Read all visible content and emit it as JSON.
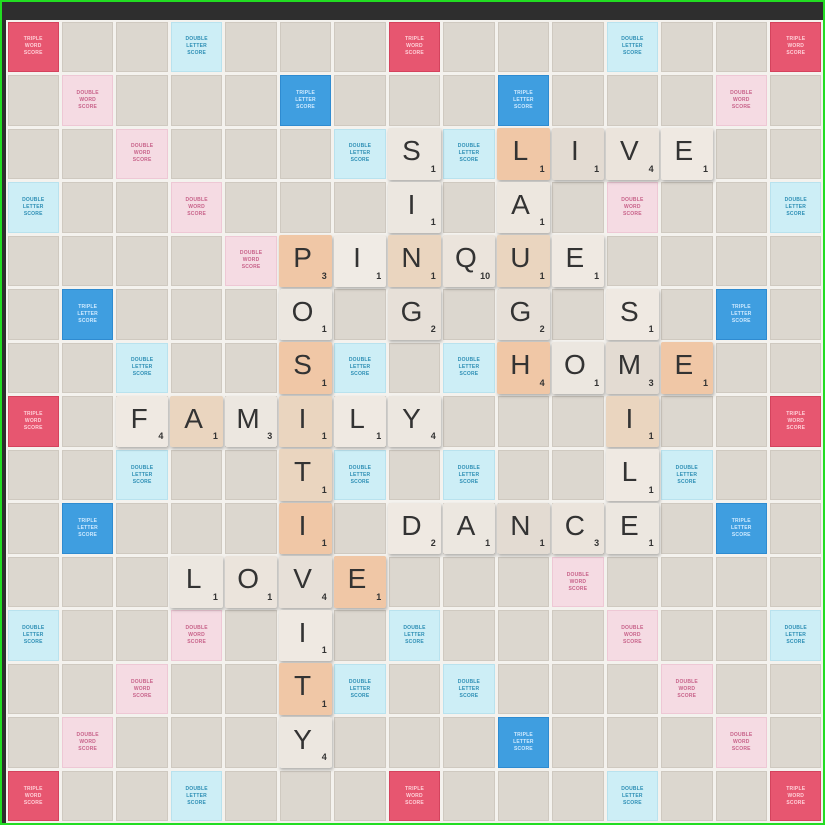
{
  "board": {
    "grid_size": 15,
    "colors": {
      "board_bg": "#f4f2ee",
      "square": "#dcd7cf",
      "double_word": "#f5dbe3",
      "double_letter": "#cdeef6",
      "triple_letter": "#3f9ee0",
      "triple_word": "#e75670",
      "frame": "#2e2e2e",
      "outline": "#22dd22"
    },
    "premium_labels": {
      "DW": [
        "DOUBLE",
        "WORD",
        "SCORE"
      ],
      "DL": [
        "DOUBLE",
        "LETTER",
        "SCORE"
      ],
      "TL": [
        "TRIPLE",
        "LETTER",
        "SCORE"
      ],
      "TW": [
        "TRIPLE",
        "WORD",
        "SCORE"
      ]
    },
    "premium_squares": [
      {
        "r": 0,
        "c": 0,
        "t": "TW"
      },
      {
        "r": 0,
        "c": 3,
        "t": "DL"
      },
      {
        "r": 0,
        "c": 7,
        "t": "TW"
      },
      {
        "r": 0,
        "c": 11,
        "t": "DL"
      },
      {
        "r": 0,
        "c": 14,
        "t": "TW"
      },
      {
        "r": 1,
        "c": 1,
        "t": "DW"
      },
      {
        "r": 1,
        "c": 5,
        "t": "TL"
      },
      {
        "r": 1,
        "c": 9,
        "t": "TL"
      },
      {
        "r": 1,
        "c": 13,
        "t": "DW"
      },
      {
        "r": 2,
        "c": 2,
        "t": "DW"
      },
      {
        "r": 2,
        "c": 6,
        "t": "DL"
      },
      {
        "r": 2,
        "c": 8,
        "t": "DL"
      },
      {
        "r": 2,
        "c": 12,
        "t": "DW"
      },
      {
        "r": 3,
        "c": 0,
        "t": "DL"
      },
      {
        "r": 3,
        "c": 3,
        "t": "DW"
      },
      {
        "r": 3,
        "c": 11,
        "t": "DW"
      },
      {
        "r": 3,
        "c": 14,
        "t": "DL"
      },
      {
        "r": 4,
        "c": 4,
        "t": "DW"
      },
      {
        "r": 4,
        "c": 10,
        "t": "DW"
      },
      {
        "r": 5,
        "c": 1,
        "t": "TL"
      },
      {
        "r": 5,
        "c": 5,
        "t": "TL"
      },
      {
        "r": 5,
        "c": 9,
        "t": "TL"
      },
      {
        "r": 5,
        "c": 13,
        "t": "TL"
      },
      {
        "r": 6,
        "c": 2,
        "t": "DL"
      },
      {
        "r": 6,
        "c": 6,
        "t": "DL"
      },
      {
        "r": 6,
        "c": 8,
        "t": "DL"
      },
      {
        "r": 6,
        "c": 12,
        "t": "DL"
      },
      {
        "r": 7,
        "c": 0,
        "t": "TW"
      },
      {
        "r": 7,
        "c": 3,
        "t": "DL"
      },
      {
        "r": 7,
        "c": 7,
        "t": "DW"
      },
      {
        "r": 7,
        "c": 11,
        "t": "DL"
      },
      {
        "r": 7,
        "c": 14,
        "t": "TW"
      },
      {
        "r": 8,
        "c": 2,
        "t": "DL"
      },
      {
        "r": 8,
        "c": 6,
        "t": "DL"
      },
      {
        "r": 8,
        "c": 8,
        "t": "DL"
      },
      {
        "r": 8,
        "c": 12,
        "t": "DL"
      },
      {
        "r": 9,
        "c": 1,
        "t": "TL"
      },
      {
        "r": 9,
        "c": 5,
        "t": "TL"
      },
      {
        "r": 9,
        "c": 9,
        "t": "TL"
      },
      {
        "r": 9,
        "c": 13,
        "t": "TL"
      },
      {
        "r": 10,
        "c": 4,
        "t": "DW"
      },
      {
        "r": 10,
        "c": 10,
        "t": "DW"
      },
      {
        "r": 11,
        "c": 0,
        "t": "DL"
      },
      {
        "r": 11,
        "c": 3,
        "t": "DW"
      },
      {
        "r": 11,
        "c": 7,
        "t": "DL"
      },
      {
        "r": 11,
        "c": 11,
        "t": "DW"
      },
      {
        "r": 11,
        "c": 14,
        "t": "DL"
      },
      {
        "r": 12,
        "c": 2,
        "t": "DW"
      },
      {
        "r": 12,
        "c": 6,
        "t": "DL"
      },
      {
        "r": 12,
        "c": 8,
        "t": "DL"
      },
      {
        "r": 12,
        "c": 12,
        "t": "DW"
      },
      {
        "r": 13,
        "c": 1,
        "t": "DW"
      },
      {
        "r": 13,
        "c": 5,
        "t": "TL"
      },
      {
        "r": 13,
        "c": 9,
        "t": "TL"
      },
      {
        "r": 13,
        "c": 13,
        "t": "DW"
      },
      {
        "r": 14,
        "c": 0,
        "t": "TW"
      },
      {
        "r": 14,
        "c": 3,
        "t": "DL"
      },
      {
        "r": 14,
        "c": 7,
        "t": "TW"
      },
      {
        "r": 14,
        "c": 11,
        "t": "DL"
      },
      {
        "r": 14,
        "c": 14,
        "t": "TW"
      }
    ],
    "tiles": [
      {
        "r": 2,
        "c": 7,
        "l": "S",
        "p": "1",
        "tone": "#ece7e0"
      },
      {
        "r": 2,
        "c": 9,
        "l": "L",
        "p": "1",
        "tone": "#f0c7a6"
      },
      {
        "r": 2,
        "c": 10,
        "l": "I",
        "p": "1",
        "tone": "#e3dbd2"
      },
      {
        "r": 2,
        "c": 11,
        "l": "V",
        "p": "4",
        "tone": "#ebe4dc"
      },
      {
        "r": 2,
        "c": 12,
        "l": "E",
        "p": "1",
        "tone": "#efe9e2"
      },
      {
        "r": 3,
        "c": 7,
        "l": "I",
        "p": "1",
        "tone": "#ece7e0"
      },
      {
        "r": 3,
        "c": 9,
        "l": "A",
        "p": "1",
        "tone": "#ede7df"
      },
      {
        "r": 4,
        "c": 5,
        "l": "P",
        "p": "3",
        "tone": "#f0c7a6"
      },
      {
        "r": 4,
        "c": 6,
        "l": "I",
        "p": "1",
        "tone": "#f0ebe5"
      },
      {
        "r": 4,
        "c": 7,
        "l": "N",
        "p": "1",
        "tone": "#ead5bf"
      },
      {
        "r": 4,
        "c": 8,
        "l": "Q",
        "p": "10",
        "tone": "#ebe4dc"
      },
      {
        "r": 4,
        "c": 9,
        "l": "U",
        "p": "1",
        "tone": "#ead5bf"
      },
      {
        "r": 4,
        "c": 10,
        "l": "E",
        "p": "1",
        "tone": "#efe9e2"
      },
      {
        "r": 5,
        "c": 5,
        "l": "O",
        "p": "1",
        "tone": "#ece7e0"
      },
      {
        "r": 5,
        "c": 7,
        "l": "G",
        "p": "2",
        "tone": "#e7e0d8"
      },
      {
        "r": 5,
        "c": 9,
        "l": "G",
        "p": "2",
        "tone": "#e7e0d8"
      },
      {
        "r": 5,
        "c": 11,
        "l": "S",
        "p": "1",
        "tone": "#efe9e2"
      },
      {
        "r": 6,
        "c": 5,
        "l": "S",
        "p": "1",
        "tone": "#f0c7a6"
      },
      {
        "r": 6,
        "c": 9,
        "l": "H",
        "p": "4",
        "tone": "#f0c7a6"
      },
      {
        "r": 6,
        "c": 10,
        "l": "O",
        "p": "1",
        "tone": "#ece7e0"
      },
      {
        "r": 6,
        "c": 11,
        "l": "M",
        "p": "3",
        "tone": "#e3dbd2"
      },
      {
        "r": 6,
        "c": 12,
        "l": "E",
        "p": "1",
        "tone": "#f0c7a6"
      },
      {
        "r": 7,
        "c": 2,
        "l": "F",
        "p": "4",
        "tone": "#efe9e2"
      },
      {
        "r": 7,
        "c": 3,
        "l": "A",
        "p": "1",
        "tone": "#ead5bf"
      },
      {
        "r": 7,
        "c": 4,
        "l": "M",
        "p": "3",
        "tone": "#ece7e0"
      },
      {
        "r": 7,
        "c": 5,
        "l": "I",
        "p": "1",
        "tone": "#ead5bf"
      },
      {
        "r": 7,
        "c": 6,
        "l": "L",
        "p": "1",
        "tone": "#efe9e2"
      },
      {
        "r": 7,
        "c": 7,
        "l": "Y",
        "p": "4",
        "tone": "#ece7e0"
      },
      {
        "r": 7,
        "c": 11,
        "l": "I",
        "p": "1",
        "tone": "#ead5bf"
      },
      {
        "r": 8,
        "c": 5,
        "l": "T",
        "p": "1",
        "tone": "#ead5bf"
      },
      {
        "r": 8,
        "c": 11,
        "l": "L",
        "p": "1",
        "tone": "#efe9e2"
      },
      {
        "r": 9,
        "c": 5,
        "l": "I",
        "p": "1",
        "tone": "#f0c7a6"
      },
      {
        "r": 9,
        "c": 7,
        "l": "D",
        "p": "2",
        "tone": "#efe9e2"
      },
      {
        "r": 9,
        "c": 8,
        "l": "A",
        "p": "1",
        "tone": "#ece7e0"
      },
      {
        "r": 9,
        "c": 9,
        "l": "N",
        "p": "1",
        "tone": "#e3dbd2"
      },
      {
        "r": 9,
        "c": 10,
        "l": "C",
        "p": "3",
        "tone": "#ebe4dc"
      },
      {
        "r": 9,
        "c": 11,
        "l": "E",
        "p": "1",
        "tone": "#ece7e0"
      },
      {
        "r": 10,
        "c": 3,
        "l": "L",
        "p": "1",
        "tone": "#ece7e0"
      },
      {
        "r": 10,
        "c": 4,
        "l": "O",
        "p": "1",
        "tone": "#ebe4dc"
      },
      {
        "r": 10,
        "c": 5,
        "l": "V",
        "p": "4",
        "tone": "#e7e0d8"
      },
      {
        "r": 10,
        "c": 6,
        "l": "E",
        "p": "1",
        "tone": "#f0c7a6"
      },
      {
        "r": 11,
        "c": 5,
        "l": "I",
        "p": "1",
        "tone": "#efe9e2"
      },
      {
        "r": 12,
        "c": 5,
        "l": "T",
        "p": "1",
        "tone": "#f0c7a6"
      },
      {
        "r": 13,
        "c": 5,
        "l": "Y",
        "p": "4",
        "tone": "#ece7e0"
      }
    ]
  }
}
